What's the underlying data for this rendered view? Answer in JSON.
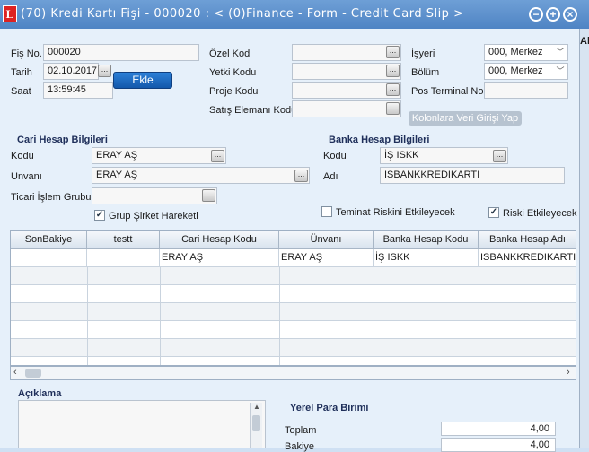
{
  "window": {
    "icon_letter": "L",
    "title": "(70) Kredi Kartı Fişi - 000020 : < (0)Finance - Form - Credit Card Slip >"
  },
  "header": {
    "fis_no_label": "Fiş No.",
    "fis_no_value": "000020",
    "tarih_label": "Tarih",
    "tarih_value": "02.10.2017",
    "saat_label": "Saat",
    "saat_value": "13:59:45",
    "ekle_label": "Ekle",
    "ozel_kod_label": "Özel Kod",
    "yetki_kodu_label": "Yetki Kodu",
    "proje_kodu_label": "Proje Kodu",
    "satis_elemani_label": "Satış Elemanı Kodu",
    "isyeri_label": "İşyeri",
    "isyeri_value": "000, Merkez",
    "bolum_label": "Bölüm",
    "bolum_value": "000, Merkez",
    "pos_terminal_label": "Pos Terminal No.",
    "kolonlara_label": "Kolonlara Veri Girişi Yap"
  },
  "cari": {
    "title": "Cari Hesap Bilgileri",
    "kodu_label": "Kodu",
    "kodu_value": "ERAY AŞ",
    "unvani_label": "Unvanı",
    "unvani_value": "ERAY AŞ",
    "ticari_label": "Ticari İşlem Grubu",
    "grup_label": "Grup Şirket Hareketi"
  },
  "banka": {
    "title": "Banka Hesap Bilgileri",
    "kodu_label": "Kodu",
    "kodu_value": "İŞ    ISKK",
    "adi_label": "Adı",
    "adi_value": "ISBANKKREDIKARTI"
  },
  "options": {
    "teminat_label": "Teminat Riskini Etkileyecek",
    "riski_label": "Riski Etkileyecek"
  },
  "grid": {
    "headers": [
      "SonBakiye",
      "testt",
      "Cari Hesap Kodu",
      "Ünvanı",
      "Banka Hesap Kodu",
      "Banka Hesap Adı"
    ],
    "row1": [
      "",
      "",
      "ERAY AŞ",
      "ERAY AŞ",
      "İŞ    ISKK",
      "ISBANKKREDIKARTI"
    ]
  },
  "bottom": {
    "aciklama_label": "Açıklama",
    "yerel_para_label": "Yerel Para Birimi",
    "toplam_label": "Toplam",
    "toplam_value": "4,00",
    "bakiye_label": "Bakiye",
    "bakiye_value": "4,00"
  },
  "side": {
    "alt_label": "Alı"
  }
}
